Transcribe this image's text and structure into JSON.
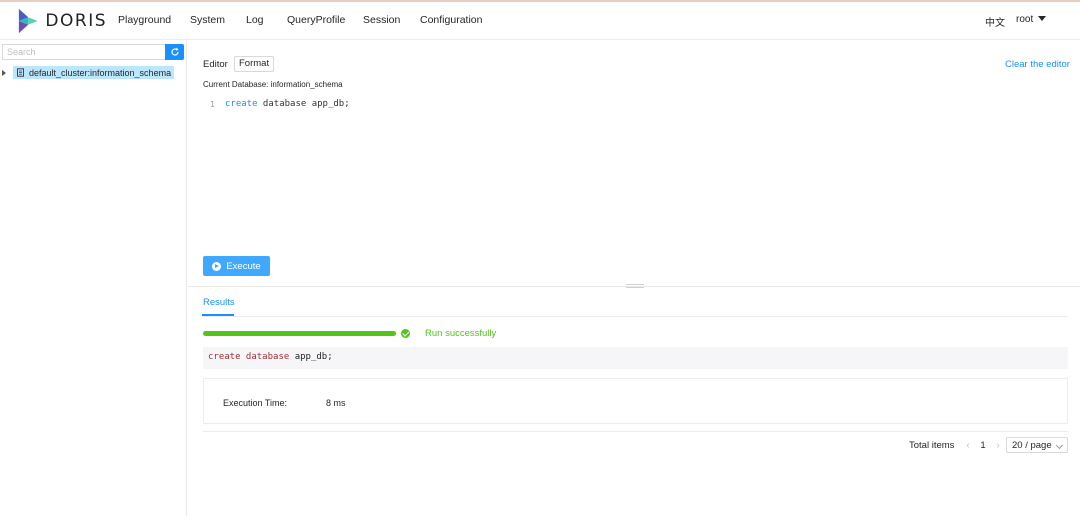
{
  "app": {
    "logo_text": "DORIS"
  },
  "nav": {
    "items": [
      {
        "label": "Playground"
      },
      {
        "label": "System"
      },
      {
        "label": "Log"
      },
      {
        "label": "QueryProfile"
      },
      {
        "label": "Session"
      },
      {
        "label": "Configuration"
      }
    ],
    "language": "中文",
    "user": "root"
  },
  "sidebar": {
    "search_placeholder": "Search",
    "tree": [
      {
        "label": "default_cluster:information_schema",
        "selected": true
      }
    ]
  },
  "editor": {
    "label": "Editor",
    "format_button": "Format",
    "clear_link": "Clear the editor",
    "current_database": "Current Database: information_schema",
    "lines": [
      {
        "number": "1",
        "keyword": "create",
        "rest": " database app_db;"
      }
    ],
    "execute_button": "Execute"
  },
  "results": {
    "tab_label": "Results",
    "progress_fraction": 1.0,
    "status_text": "Run successfully",
    "status_color": "#52c41a",
    "sql_keyword": "create database",
    "sql_rest": " app_db;",
    "execution_time_label": "Execution Time:",
    "execution_time_value": "8 ms"
  },
  "pagination": {
    "total_label": "Total items",
    "current_page": "1",
    "page_size": "20 / page"
  },
  "colors": {
    "accent": "#1890ff",
    "success": "#52c41a"
  }
}
